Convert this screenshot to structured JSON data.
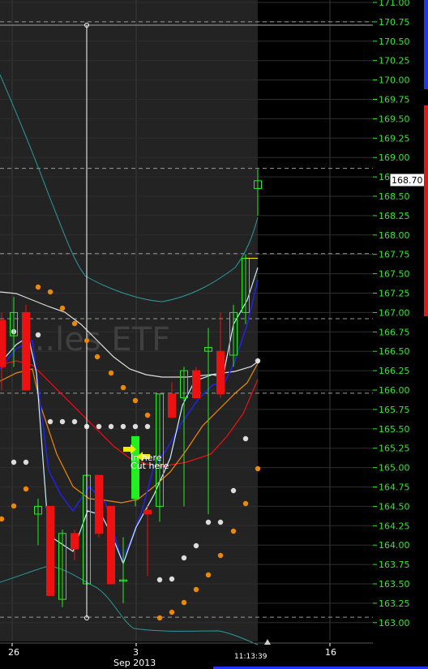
{
  "chart_data": {
    "type": "candlestick",
    "watermark": "...les ETF",
    "annotations": [
      "In here",
      "Cut here"
    ],
    "y_range": [
      162.9,
      171.0
    ],
    "y_ticks": [
      "171.00",
      "170.75",
      "170.50",
      "170.25",
      "170.00",
      "169.75",
      "169.50",
      "169.25",
      "169.00",
      "168.75",
      "168.50",
      "168.25",
      "168.00",
      "167.75",
      "167.50",
      "167.25",
      "167.00",
      "166.75",
      "166.50",
      "166.25",
      "166.00",
      "165.75",
      "165.50",
      "165.25",
      "165.00",
      "164.75",
      "164.50",
      "164.25",
      "164.00",
      "163.75",
      "163.50",
      "163.25",
      "163.00"
    ],
    "last_price_label": "168.70",
    "x_labels": [
      "26",
      "3",
      "16"
    ],
    "x_sublabel": "Sep 2013",
    "timestamp": "11:13:39",
    "colors": {
      "up": "#22ee22",
      "down": "#ee1111",
      "bollinger": "#2a9a9a",
      "ema_fast": "#ffffff",
      "ema_mid": "#2222ee",
      "ema_slow": "#ee1111",
      "ema_orange": "#ee8800",
      "price_text": "#32e632"
    },
    "candles": [
      {
        "o": 166.9,
        "h": 167.0,
        "l": 166.0,
        "c": 166.3
      },
      {
        "o": 166.7,
        "h": 167.2,
        "l": 166.3,
        "c": 167.0
      },
      {
        "o": 167.0,
        "h": 167.1,
        "l": 166.0,
        "c": 166.0
      },
      {
        "o": 164.4,
        "h": 164.6,
        "l": 164.0,
        "c": 164.5
      },
      {
        "o": 164.5,
        "h": 164.5,
        "l": 163.35,
        "c": 163.35
      },
      {
        "o": 163.3,
        "h": 164.2,
        "l": 163.2,
        "c": 164.15
      },
      {
        "o": 164.15,
        "h": 164.2,
        "l": 163.8,
        "c": 163.95
      },
      {
        "o": 163.5,
        "h": 165.0,
        "l": 163.5,
        "c": 164.9
      },
      {
        "o": 164.9,
        "h": 164.9,
        "l": 164.1,
        "c": 164.15
      },
      {
        "o": 164.5,
        "h": 164.5,
        "l": 163.5,
        "c": 163.5
      },
      {
        "o": 163.55,
        "h": 164.1,
        "l": 163.25,
        "c": 163.55
      },
      {
        "o": 164.6,
        "h": 165.4,
        "l": 164.5,
        "c": 165.4
      },
      {
        "o": 164.45,
        "h": 164.5,
        "l": 163.6,
        "c": 164.4
      },
      {
        "o": 164.5,
        "h": 165.95,
        "l": 164.3,
        "c": 165.95
      },
      {
        "o": 165.95,
        "h": 166.1,
        "l": 165.7,
        "c": 165.65
      },
      {
        "o": 165.9,
        "h": 166.3,
        "l": 164.5,
        "c": 166.25
      },
      {
        "o": 166.25,
        "h": 166.3,
        "l": 165.9,
        "c": 165.9
      },
      {
        "o": 166.5,
        "h": 166.8,
        "l": 164.4,
        "c": 166.55
      },
      {
        "o": 166.5,
        "h": 167.0,
        "l": 165.9,
        "c": 165.95
      },
      {
        "o": 166.45,
        "h": 167.1,
        "l": 166.3,
        "c": 167.0
      },
      {
        "o": 167.0,
        "h": 167.75,
        "l": 166.85,
        "c": 167.7
      },
      {
        "o": 168.6,
        "h": 168.85,
        "l": 168.25,
        "c": 168.7
      }
    ]
  }
}
